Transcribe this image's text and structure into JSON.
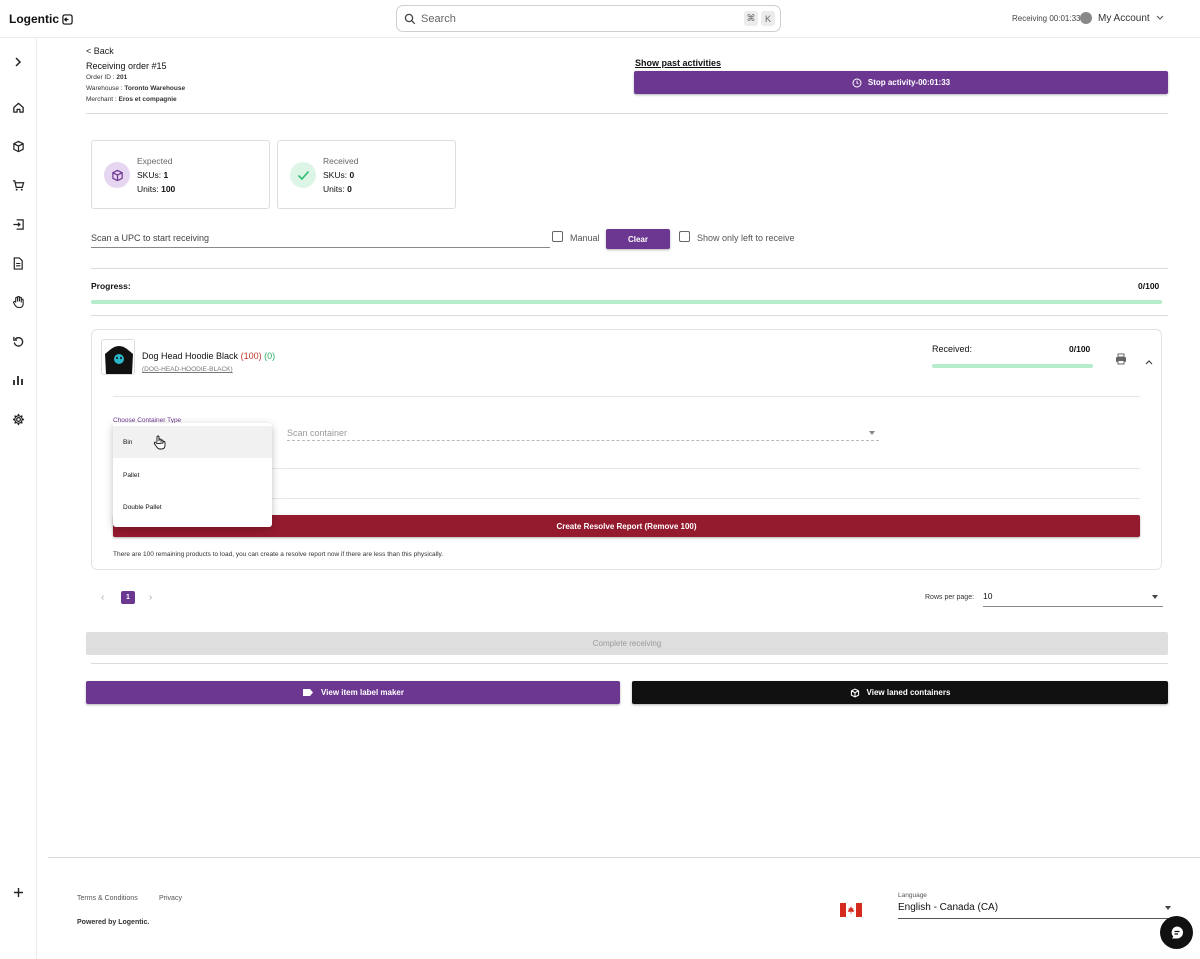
{
  "app": {
    "logo": "Logentic",
    "search_placeholder": "Search",
    "search_kbd_1": "⌘",
    "search_kbd_2": "K",
    "receiving_timer": "Receiving 00:01:33",
    "account_label": "My Account"
  },
  "sidebar": {
    "icons": [
      "chevron-right-icon",
      "home-icon",
      "box-icon",
      "cart-icon",
      "login-icon",
      "document-icon",
      "hand-icon",
      "undo-icon",
      "bar-chart-icon",
      "gear-icon",
      "plus-icon"
    ]
  },
  "header": {
    "back": "< Back",
    "title": "Receiving order #15",
    "order_id_label": "Order ID : ",
    "order_id": "201",
    "warehouse_label": "Warehouse : ",
    "warehouse": "Toronto Warehouse",
    "merchant_label": "Merchant : ",
    "merchant": "Eros et compagnie",
    "past_activities": "Show past activities",
    "stop_activity": "Stop activity-00:01:33"
  },
  "stats": {
    "expected": {
      "label": "Expected",
      "skus_label": "SKUs: ",
      "skus": "1",
      "units_label": "Units: ",
      "units": "100"
    },
    "received": {
      "label": "Received",
      "skus_label": "SKUs: ",
      "skus": "0",
      "units_label": "Units: ",
      "units": "0"
    }
  },
  "scan": {
    "upc_placeholder": "Scan a UPC to start receiving",
    "manual_label": "Manual",
    "clear_label": "Clear",
    "only_left_label": "Show only left to receive"
  },
  "progress": {
    "label": "Progress:",
    "value": "0/100",
    "fraction": 0
  },
  "item": {
    "name": "Dog Head Hoodie Black",
    "expected_count": "(100)",
    "received_count": "(0)",
    "sku": "(DOG-HEAD-HOODIE-BLACK)",
    "received_label": "Received:",
    "received_value": "0/100",
    "received_fraction": 0,
    "container_type_label": "Choose Container Type",
    "scan_container_placeholder": "Scan container",
    "container_options": [
      "Bin",
      "Pallet",
      "Double Pallet"
    ],
    "highlighted_option": "Bin",
    "resolve_button": "Create Resolve Report (Remove 100)",
    "resolve_note": "There are 100 remaining products to load, you can create a resolve report now if there are less than this physically."
  },
  "pagination": {
    "current_page": "1",
    "rows_per_page_label": "Rows per page:",
    "rows_per_page": "10"
  },
  "actions": {
    "complete_receiving": "Complete receiving",
    "label_maker": "View item label maker",
    "laned_containers": "View laned containers"
  },
  "footer": {
    "terms": "Terms & Conditions",
    "privacy": "Privacy",
    "powered": "Powered by Logentic.",
    "language_label": "Language",
    "language": "English - Canada (CA)"
  },
  "colors": {
    "brand_purple": "#6c3791",
    "danger_red": "#941a2e",
    "progress_green": "#2ebd6b",
    "progress_track": "#b6ebcc"
  }
}
